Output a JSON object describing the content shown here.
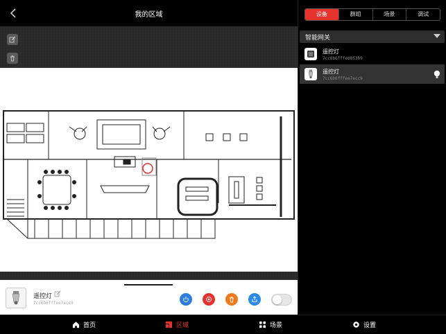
{
  "header": {
    "title": "我的区域"
  },
  "device_bar": {
    "name": "遥控灯",
    "id": "7cc6b6fffee7ecc9",
    "toggle_on": false
  },
  "right_panel": {
    "tabs": [
      {
        "label": "设备",
        "active": true
      },
      {
        "label": "群组",
        "active": false
      },
      {
        "label": "场景",
        "active": false
      },
      {
        "label": "调试",
        "active": false
      }
    ],
    "gateway": {
      "label": "智能网关"
    },
    "devices": [
      {
        "name": "遥控灯",
        "id": "7cc6b6fffed853b9",
        "selected": false
      },
      {
        "name": "遥控灯",
        "id": "7cc6b6fffee7ecc9",
        "selected": true
      }
    ]
  },
  "bottom_nav": [
    {
      "label": "首页",
      "icon": "home-icon",
      "active": false
    },
    {
      "label": "区域",
      "icon": "area-icon",
      "active": true
    },
    {
      "label": "场景",
      "icon": "scene-icon",
      "active": false
    },
    {
      "label": "设置",
      "icon": "gear-icon",
      "active": false
    }
  ],
  "colors": {
    "accent": "#e6322d",
    "power": "#2b7de0",
    "locate": "#e6322d",
    "delete": "#f07a1a",
    "share": "#2b8be6"
  }
}
